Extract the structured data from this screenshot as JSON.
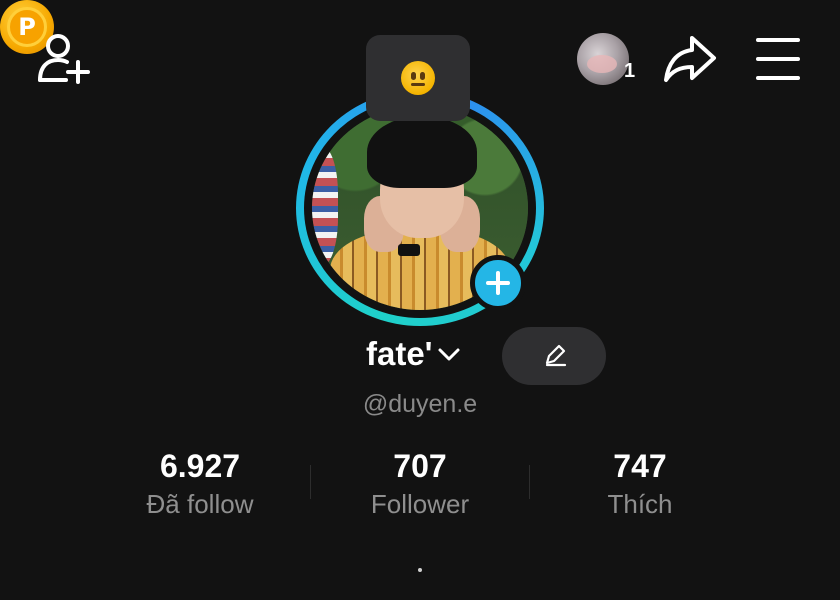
{
  "header": {
    "add_friend_icon": "add-user-icon",
    "coin_label": "P",
    "coin_icon": "coin-icon",
    "status_emoji": "slightly-smiling-face",
    "story_count": "1",
    "share_icon": "share-arrow-icon",
    "menu_icon": "hamburger-menu-icon"
  },
  "profile": {
    "name": "fate'",
    "username": "@duyen.e",
    "ring_color": "#20b7e8",
    "plus_color": "#24b6e6"
  },
  "stats": [
    {
      "value": "6.927",
      "label": "Đã follow"
    },
    {
      "value": "707",
      "label": "Follower"
    },
    {
      "value": "747",
      "label": "Thích"
    }
  ]
}
